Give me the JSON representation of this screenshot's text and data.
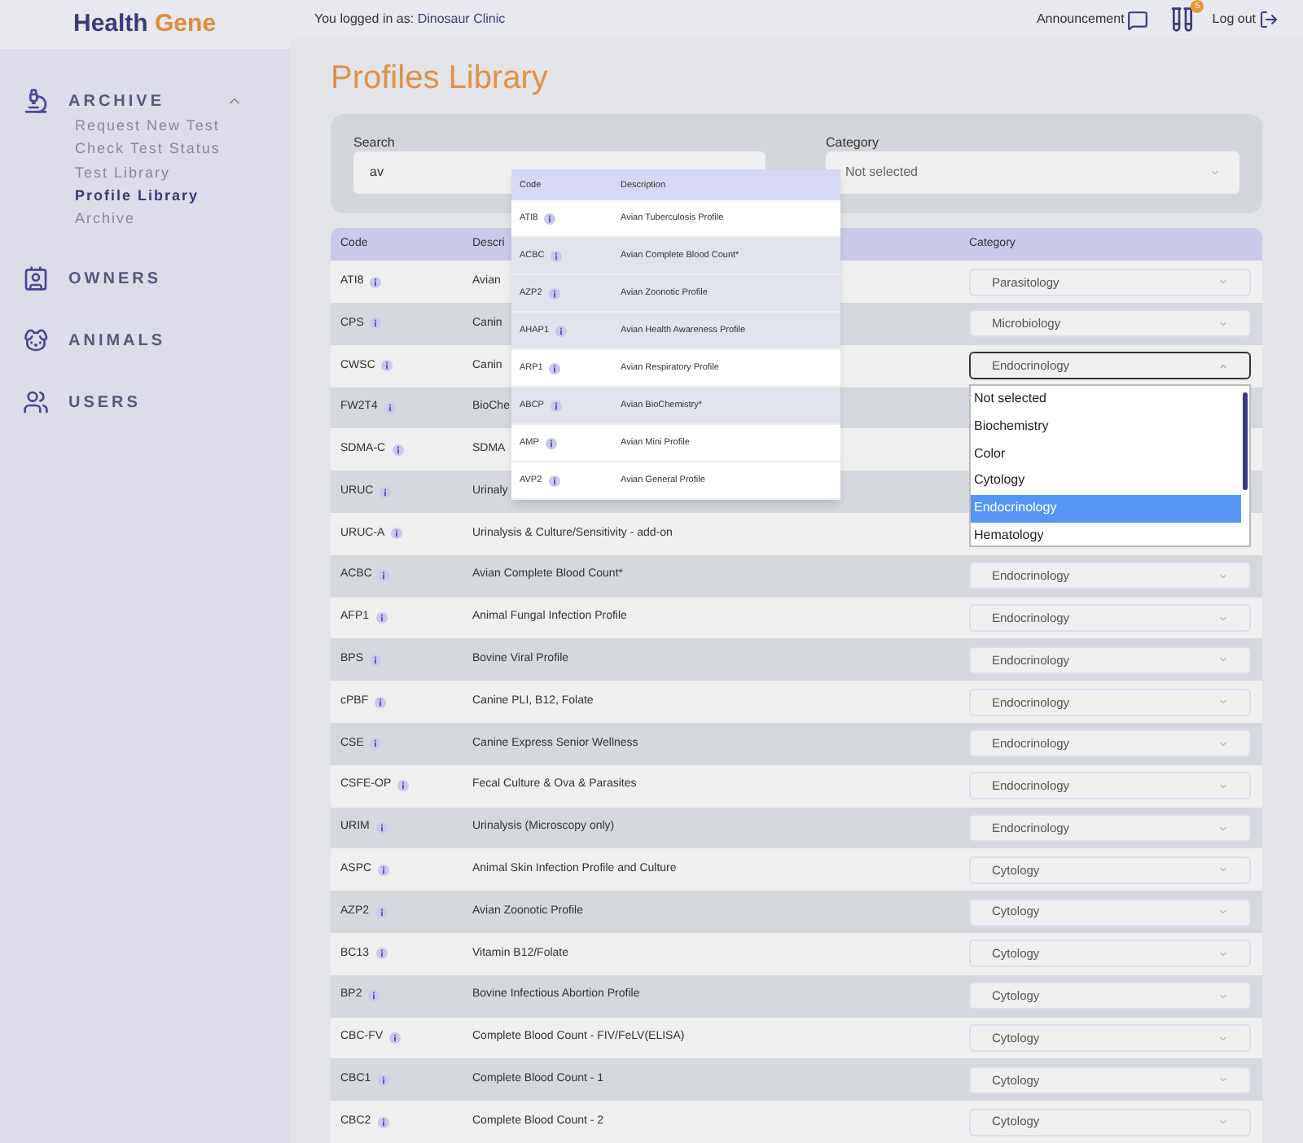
{
  "logo": {
    "first": "Health",
    "second": "Gene"
  },
  "header": {
    "login_label": "You logged in as:",
    "clinic": "Dinosaur Clinic",
    "announcement": "Announcement",
    "tubes_badge": "5",
    "logout": "Log out"
  },
  "sidebar": {
    "sections": [
      {
        "kind": "archive",
        "label": "ARCHIVE",
        "expanded": true,
        "children": [
          {
            "label": "Request New Test",
            "selected": false
          },
          {
            "label": "Check Test Status",
            "selected": false
          },
          {
            "label": "Test Library",
            "selected": false
          },
          {
            "label": "Profile Library",
            "selected": true
          },
          {
            "label": "Archive",
            "selected": false
          }
        ]
      },
      {
        "kind": "owners",
        "label": "OWNERS"
      },
      {
        "kind": "animals",
        "label": "ANIMALS"
      },
      {
        "kind": "users",
        "label": "USERS"
      }
    ]
  },
  "page_title": "Profiles Library",
  "filters": {
    "search_label": "Search",
    "search_value": "av",
    "category_label": "Category",
    "category_value": "Not selected"
  },
  "table": {
    "columns": [
      "Code",
      "Descri",
      "Category"
    ],
    "rows": [
      {
        "code": "ATI8",
        "description": "Avian",
        "category": "Parasitology",
        "open": false
      },
      {
        "code": "CPS",
        "description": "Canin",
        "category": "Microbiology",
        "open": false
      },
      {
        "code": "CWSC",
        "description": "Canin",
        "category": "Endocrinology",
        "open": true
      },
      {
        "code": "FW2T4",
        "description": "BioChe"
      },
      {
        "code": "SDMA-C",
        "description": "SDMA"
      },
      {
        "code": "URUC",
        "description": "Urinaly"
      },
      {
        "code": "URUC-A",
        "description": "Urinalysis & Culture/Sensitivity - add-on"
      },
      {
        "code": "ACBC",
        "description": "Avian Complete Blood Count*",
        "category": "Endocrinology",
        "open": false
      },
      {
        "code": "AFP1",
        "description": "Animal Fungal Infection Profile",
        "category": "Endocrinology",
        "open": false
      },
      {
        "code": "BPS",
        "description": "Bovine Viral Profile",
        "category": "Endocrinology",
        "open": false
      },
      {
        "code": "cPBF",
        "description": "Canine PLI, B12, Folate",
        "category": "Endocrinology",
        "open": false
      },
      {
        "code": "CSE",
        "description": "Canine Express Senior Wellness",
        "category": "Endocrinology",
        "open": false
      },
      {
        "code": "CSFE-OP",
        "description": "Fecal Culture & Ova & Parasites",
        "category": "Endocrinology",
        "open": false
      },
      {
        "code": "URIM",
        "description": "Urinalysis (Microscopy only)",
        "category": "Endocrinology",
        "open": false
      },
      {
        "code": "ASPC",
        "description": "Animal Skin Infection Profile and Culture",
        "category": "Cytology",
        "open": false
      },
      {
        "code": "AZP2",
        "description": "Avian Zoonotic Profile",
        "category": "Cytology",
        "open": false
      },
      {
        "code": "BC13",
        "description": "Vitamin B12/Folate",
        "category": "Cytology",
        "open": false
      },
      {
        "code": "BP2",
        "description": "Bovine Infectious Abortion Profile",
        "category": "Cytology",
        "open": false
      },
      {
        "code": "CBC-FV",
        "description": "Complete Blood Count - FIV/FeLV(ELISA)",
        "category": "Cytology",
        "open": false
      },
      {
        "code": "CBC1",
        "description": "Complete Blood Count - 1",
        "category": "Cytology",
        "open": false
      },
      {
        "code": "CBC2",
        "description": "Complete Blood Count - 2",
        "category": "Cytology",
        "open": false
      }
    ]
  },
  "search_results": {
    "columns": [
      "Code",
      "Description"
    ],
    "rows": [
      {
        "code": "ATI8",
        "description": "Avian Tuberculosis Profile",
        "shaded": false
      },
      {
        "code": "ACBC",
        "description": "Avian Complete Blood Count*",
        "shaded": true
      },
      {
        "code": "AZP2",
        "description": "Avian Zoonotic Profile",
        "shaded": true
      },
      {
        "code": "AHAP1",
        "description": "Avian Health Awareness Profile",
        "shaded": true
      },
      {
        "code": "ARP1",
        "description": "Avian Respiratory Profile",
        "shaded": false
      },
      {
        "code": "ABCP",
        "description": "Avian BioChemistry*",
        "shaded": true
      },
      {
        "code": "AMP",
        "description": "Avian Mini Profile",
        "shaded": false
      },
      {
        "code": "AVP2",
        "description": "Avian General Profile",
        "shaded": false
      }
    ]
  },
  "category_options": [
    {
      "label": "Not selected",
      "selected": false
    },
    {
      "label": "Biochemistry",
      "selected": false
    },
    {
      "label": "Color",
      "selected": false
    },
    {
      "label": "Cytology",
      "selected": false
    },
    {
      "label": "Endocrinology",
      "selected": true
    },
    {
      "label": "Hematology",
      "selected": false
    }
  ]
}
